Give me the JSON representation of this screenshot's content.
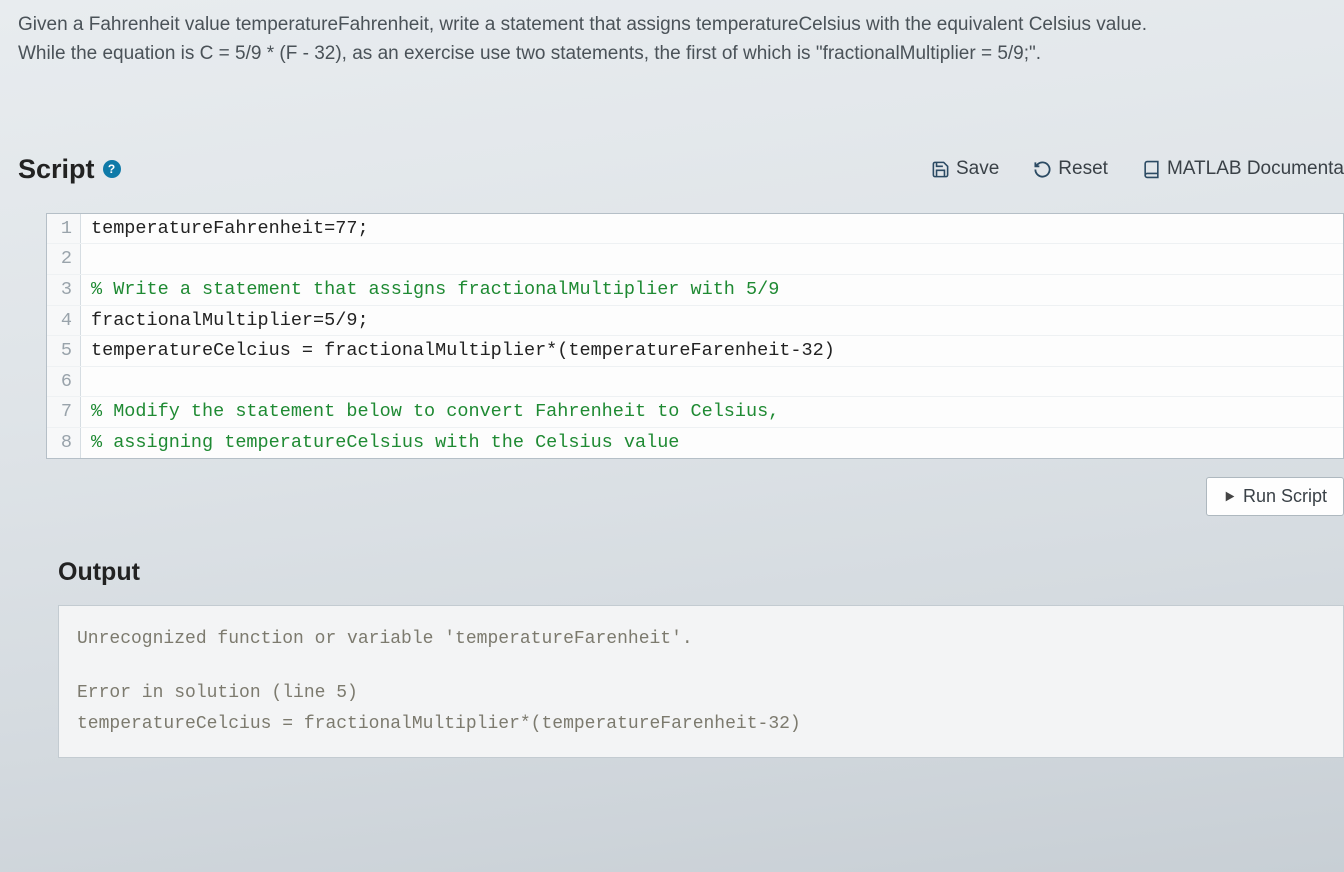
{
  "problem": {
    "line1": "Given a Fahrenheit value temperatureFahrenheit, write a statement that assigns temperatureCelsius with the equivalent Celsius value.",
    "line2": "While the equation is C = 5/9 * (F - 32), as an exercise use two statements, the first of which is \"fractionalMultiplier = 5/9;\"."
  },
  "script": {
    "title": "Script",
    "toolbar": {
      "save": "Save",
      "reset": "Reset",
      "docs": "MATLAB Documenta"
    }
  },
  "code": {
    "lines": [
      {
        "n": "1",
        "text": "temperatureFahrenheit=77;",
        "comment": false
      },
      {
        "n": "2",
        "text": "",
        "comment": false
      },
      {
        "n": "3",
        "text": "% Write a statement that assigns fractionalMultiplier with 5/9",
        "comment": true
      },
      {
        "n": "4",
        "text": "fractionalMultiplier=5/9;",
        "comment": false
      },
      {
        "n": "5",
        "text": "temperatureCelcius = fractionalMultiplier*(temperatureFarenheit-32)",
        "comment": false
      },
      {
        "n": "6",
        "text": "",
        "comment": false
      },
      {
        "n": "7",
        "text": "% Modify the statement below to convert Fahrenheit to Celsius,",
        "comment": true
      },
      {
        "n": "8",
        "text": "% assigning temperatureCelsius with the Celsius value",
        "comment": true
      }
    ]
  },
  "run_label": "Run Script",
  "output": {
    "title": "Output",
    "lines": [
      "Unrecognized function or variable 'temperatureFarenheit'.",
      "",
      "Error in solution (line 5)",
      "temperatureCelcius = fractionalMultiplier*(temperatureFarenheit-32)"
    ]
  }
}
